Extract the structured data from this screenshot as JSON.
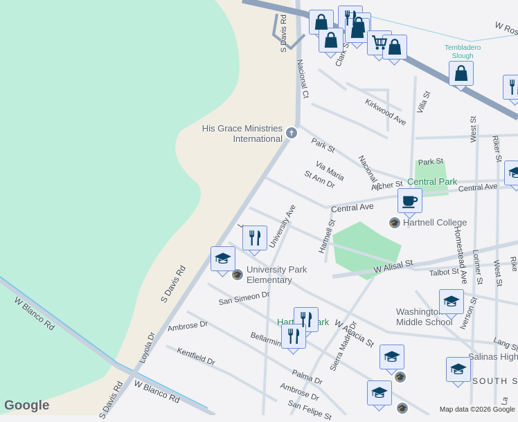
{
  "map": {
    "streets": {
      "s_davis_rd_top": "S Davis Rd",
      "s_davis_rd_mid": "S Davis Rd",
      "s_davis_rd_bottom": "S Davis Rd",
      "w_blanco_rd_left": "W Blanco Rd",
      "w_blanco_rd_right": "W Blanco Rd",
      "nacional_ct": "Nacional Ct",
      "clark_st": "Clark St",
      "w_rossi": "W Ros",
      "kirkwood_ave": "Kirkwood Ave",
      "villa_st": "Villa St",
      "park_st_left": "Park St",
      "park_st_right": "Park St",
      "via_maria": "Via Maria",
      "nacional_st": "Nacional St",
      "st_ann_dr": "St Ann Dr",
      "archer_st": "Archer St",
      "central_ave_main": "Central Ave",
      "central_ave_right": "Central Ave",
      "west_st_top": "West St",
      "riker_st_top": "Riker St",
      "university_ave": "University Ave",
      "hartnell_st": "Hartnell St",
      "w_alisal_st": "W Alisal St",
      "homestead_ave": "Homestead Ave",
      "lorimer_st": "Lorimer St",
      "west_st_bottom": "West St",
      "riker_bottom": "Rike",
      "talbot_st": "Talbot St",
      "san_simeon_dr": "San Simeon Dr",
      "ambrose_dr_left": "Ambrose Dr",
      "loyola_dr": "Loyola Dr",
      "kentfield_dr": "Kentfield Dr",
      "bellarmine": "Bellarmine",
      "w_acacia_st": "W Acacia St",
      "sierra_madre_dr": "Sierra Madre Dr",
      "palma_dr": "Palma Dr",
      "ambrose_dr_right": "Ambrose Dr",
      "san_felipe_st": "San Felipe St",
      "iverson_st": "Iverson St",
      "lang_st": "Lang St",
      "la_partial": "La"
    },
    "places": {
      "his_grace": "His Grace Ministries International",
      "his_grace_line1": "His Grace Ministries",
      "his_grace_line2": "International",
      "central_park": "Central Park",
      "hartnell_college": "Hartnell College",
      "university_park_line1": "University Park",
      "university_park_line2": "Elementary",
      "washington_line1": "Washington",
      "washington_line2": "Middle School",
      "salinas_high": "Salinas High",
      "hartnell_park": "Hartnell Park",
      "south_salinas": "SOUTH SA",
      "tembladero_line1": "Tembladero",
      "tembladero_line2": "Slough"
    },
    "markers": [
      {
        "type": "shopping-bag"
      },
      {
        "type": "restaurant"
      },
      {
        "type": "shopping-bag"
      },
      {
        "type": "shopping-bag"
      },
      {
        "type": "shopping-bag"
      },
      {
        "type": "grocery-cart"
      },
      {
        "type": "shopping-bag"
      },
      {
        "type": "shopping-bag"
      },
      {
        "type": "restaurant"
      },
      {
        "type": "school"
      },
      {
        "type": "cafe"
      },
      {
        "type": "restaurant"
      },
      {
        "type": "school"
      },
      {
        "type": "school"
      },
      {
        "type": "restaurant"
      },
      {
        "type": "restaurant"
      },
      {
        "type": "school"
      },
      {
        "type": "school"
      },
      {
        "type": "school"
      }
    ],
    "colors": {
      "park": "#bdebd6",
      "sand": "#f1ede3",
      "urban": "#f3f2f4",
      "highway": "#8fa3bd",
      "marker_icon": "#0b4466",
      "marker_bg": "#e6ecfb"
    },
    "logo": "Google",
    "attribution": "Map data ©2026 Google"
  }
}
